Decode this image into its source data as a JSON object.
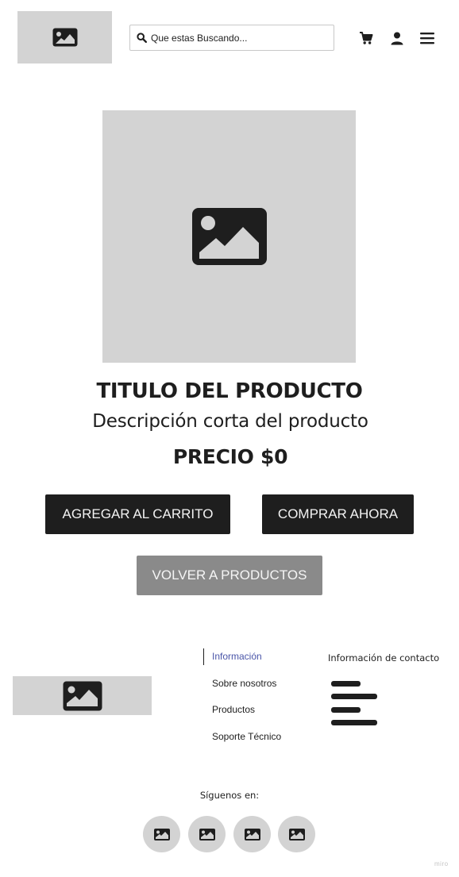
{
  "header": {
    "logo_icon": "image-placeholder-icon",
    "search": {
      "placeholder": "Que estas Buscando...",
      "value": "",
      "icon": "search-icon"
    },
    "icons": [
      "cart-icon",
      "user-icon",
      "menu-icon"
    ]
  },
  "product": {
    "image_icon": "image-placeholder-icon",
    "title": "TITULO DEL PRODUCTO",
    "description": "Descripción corta del producto",
    "price": "PRECIO $0"
  },
  "actions": {
    "add_to_cart": "AGREGAR AL CARRITO",
    "buy_now": "COMPRAR AHORA",
    "back_to_products": "VOLVER A PRODUCTOS"
  },
  "footer": {
    "links": [
      "Información",
      "Sobre nosotros",
      "Productos",
      "Soporte Técnico"
    ],
    "active_link": "Información",
    "contact_title": "Información de contacto",
    "follow_label": "Síguenos en:",
    "social_icons": [
      "image-placeholder-icon",
      "image-placeholder-icon",
      "image-placeholder-icon",
      "image-placeholder-icon"
    ]
  },
  "watermark": "miro",
  "colors": {
    "placeholder_bg": "#d3d3d3",
    "dark_button": "#1e1e1e",
    "grey_button": "#8a8a8a",
    "active_link": "#4a55a8",
    "text": "#1e1e1e"
  }
}
